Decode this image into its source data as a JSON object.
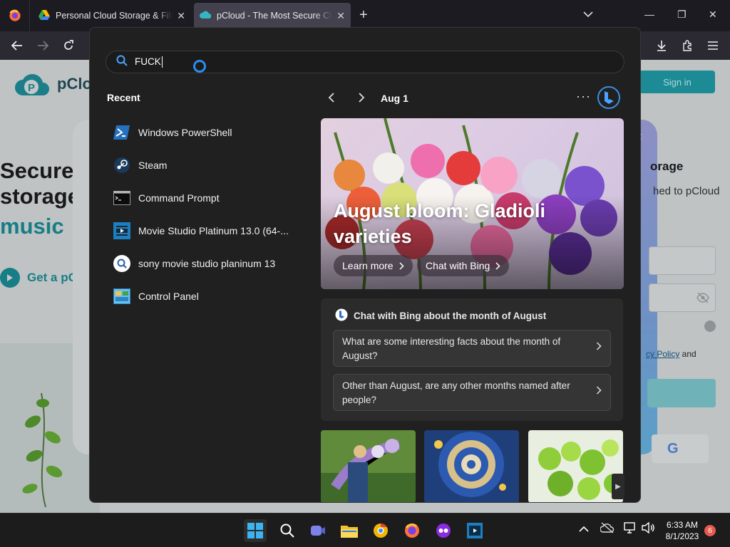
{
  "browser": {
    "tabs": [
      {
        "title": "Personal Cloud Storage & File S",
        "active": false
      },
      {
        "title": "pCloud - The Most Secure Clou",
        "active": true
      }
    ]
  },
  "page": {
    "logo_text": "pCloud",
    "signin_label": "Sign in",
    "hero_line1": "Secure",
    "hero_line2": "storage",
    "hero_line3": "music",
    "get_label": "Get a pC",
    "right_title": "orage",
    "right_sub": "hed to pCloud",
    "policy_prefix": "cy Policy",
    "policy_suffix": " and",
    "google_letter": "G"
  },
  "search": {
    "query": "FUCK"
  },
  "recent": {
    "title": "Recent",
    "items": [
      {
        "label": "Windows PowerShell",
        "icon": "powershell-icon"
      },
      {
        "label": "Steam",
        "icon": "steam-icon"
      },
      {
        "label": "Command Prompt",
        "icon": "cmd-icon"
      },
      {
        "label": "Movie Studio Platinum 13.0 (64-...",
        "icon": "movie-studio-icon"
      },
      {
        "label": "sony movie studio planinum 13",
        "icon": "web-search-icon"
      },
      {
        "label": "Control Panel",
        "icon": "control-panel-icon"
      }
    ]
  },
  "highlights": {
    "date": "Aug 1",
    "more": "···",
    "hero_title_line1": "August bloom: Gladioli",
    "hero_title_line2": "varieties",
    "learn_more": "Learn more",
    "chat_with_bing": "Chat with Bing",
    "chat_card_title": "Chat with Bing about the month of August",
    "questions": [
      "What are some interesting facts about the month of August?",
      "Other than August, are any other months named after people?"
    ]
  },
  "taskbar": {
    "time": "6:33 AM",
    "date": "8/1/2023",
    "notification_count": "6"
  },
  "colors": {
    "accent_blue": "#2b8ef0",
    "pcloud_teal": "#177d86",
    "flyout_bg": "#202020"
  }
}
